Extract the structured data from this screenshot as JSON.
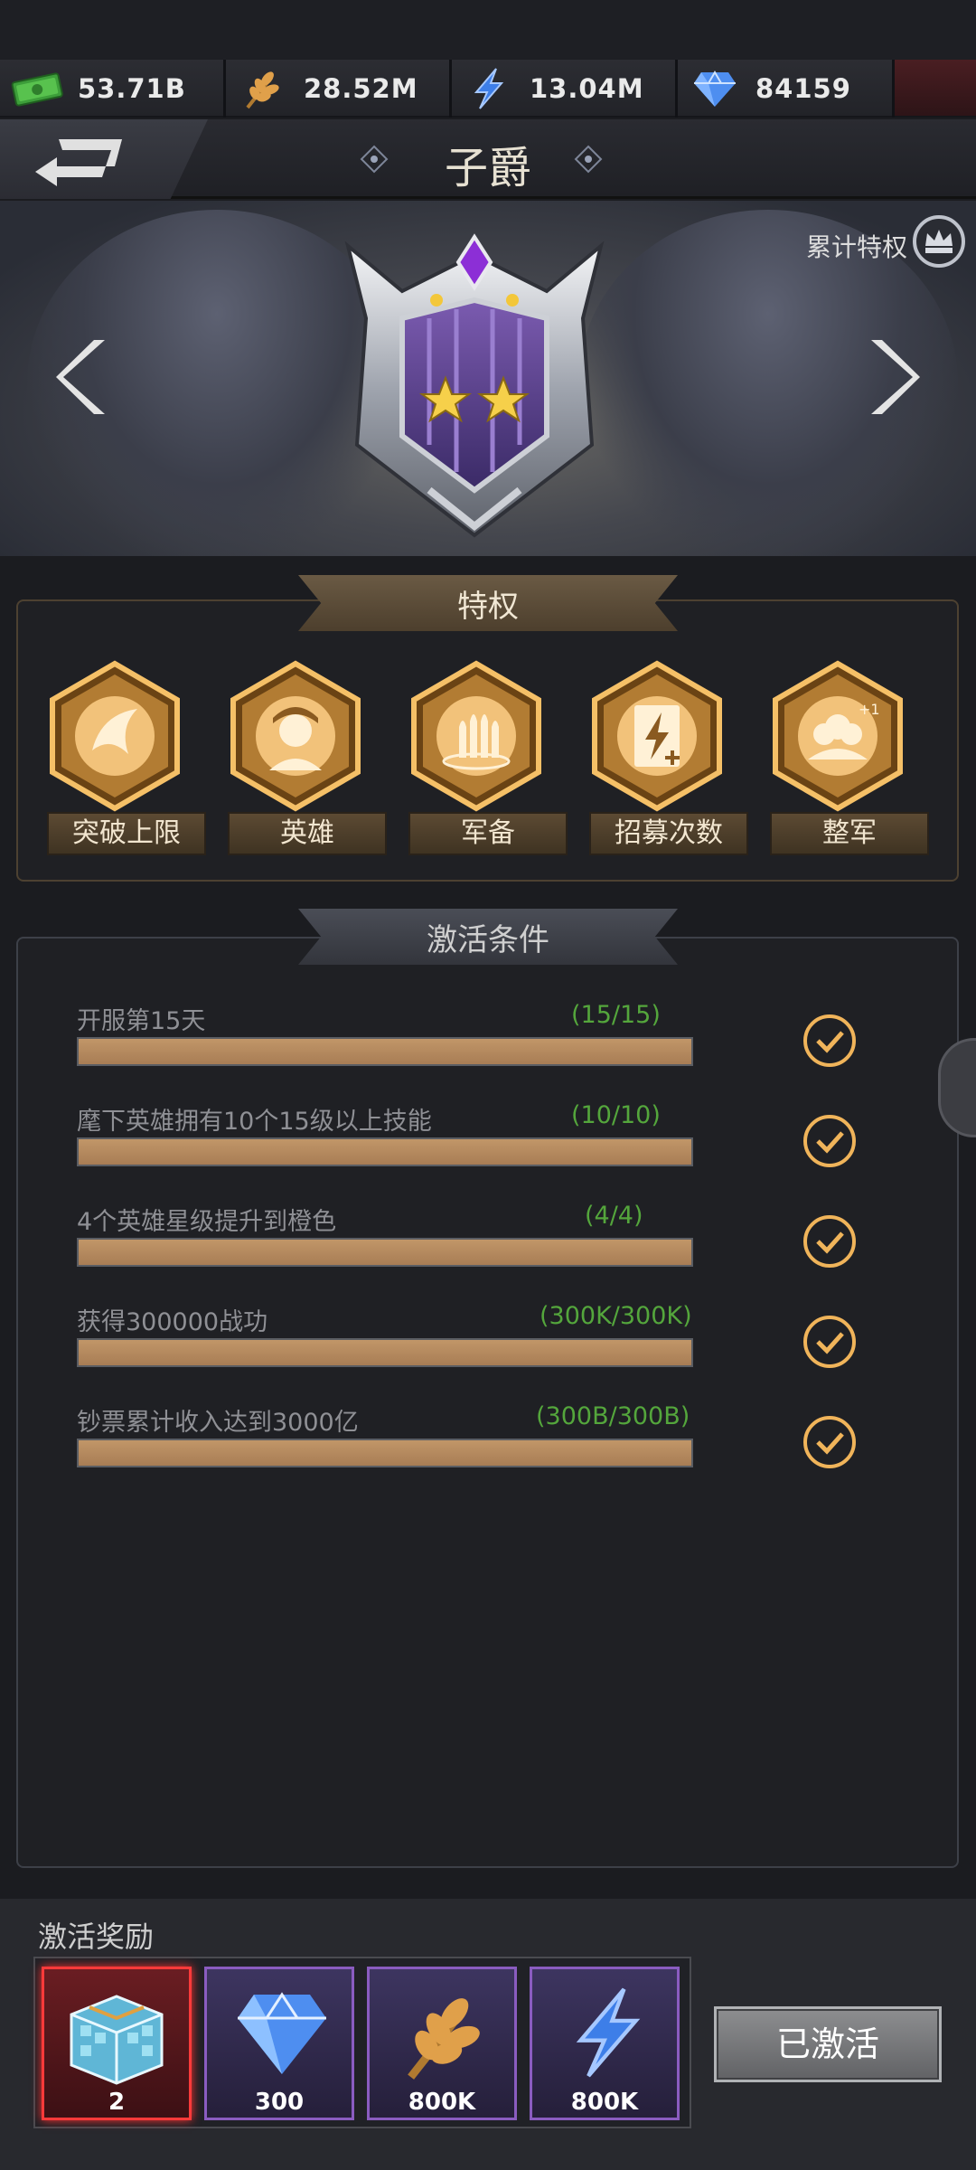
{
  "resources": [
    {
      "icon": "cash-icon",
      "value": "53.71B"
    },
    {
      "icon": "wheat-icon",
      "value": "28.52M"
    },
    {
      "icon": "lightning-icon",
      "value": "13.04M"
    },
    {
      "icon": "diamond-icon",
      "value": "84159"
    }
  ],
  "header": {
    "title": "子爵"
  },
  "hero": {
    "cumulative_label": "累计特权",
    "stars": 2
  },
  "privileges": {
    "title": "特权",
    "items": [
      {
        "icon": "breakthrough-icon",
        "label": "突破上限"
      },
      {
        "icon": "hero-icon",
        "label": "英雄"
      },
      {
        "icon": "ammo-icon",
        "label": "军备"
      },
      {
        "icon": "recruit-card-icon",
        "label": "招募次数"
      },
      {
        "icon": "troops-icon",
        "label": "整军"
      }
    ]
  },
  "conditions": {
    "title": "激活条件",
    "items": [
      {
        "text": "开服第15天",
        "progress": "(15/15)",
        "fill": 1.0,
        "done": true
      },
      {
        "text": "麾下英雄拥有10个15级以上技能",
        "progress": "(10/10)",
        "fill": 1.0,
        "done": true
      },
      {
        "text": "4个英雄星级提升到橙色",
        "progress": "(4/4)",
        "fill": 1.0,
        "done": true
      },
      {
        "text": "获得300000战功",
        "progress": "(300K/300K)",
        "fill": 1.0,
        "done": true
      },
      {
        "text": "钞票累计收入达到3000亿",
        "progress": "(300B/300B)",
        "fill": 1.0,
        "done": true
      }
    ]
  },
  "rewards": {
    "title": "激活奖励",
    "items": [
      {
        "icon": "crate-icon",
        "value": "2",
        "rarity": "red"
      },
      {
        "icon": "diamond-icon",
        "value": "300",
        "rarity": "purple"
      },
      {
        "icon": "wheat-icon",
        "value": "800K",
        "rarity": "purple"
      },
      {
        "icon": "lightning-icon",
        "value": "800K",
        "rarity": "purple"
      }
    ]
  },
  "action": {
    "label": "已激活"
  }
}
